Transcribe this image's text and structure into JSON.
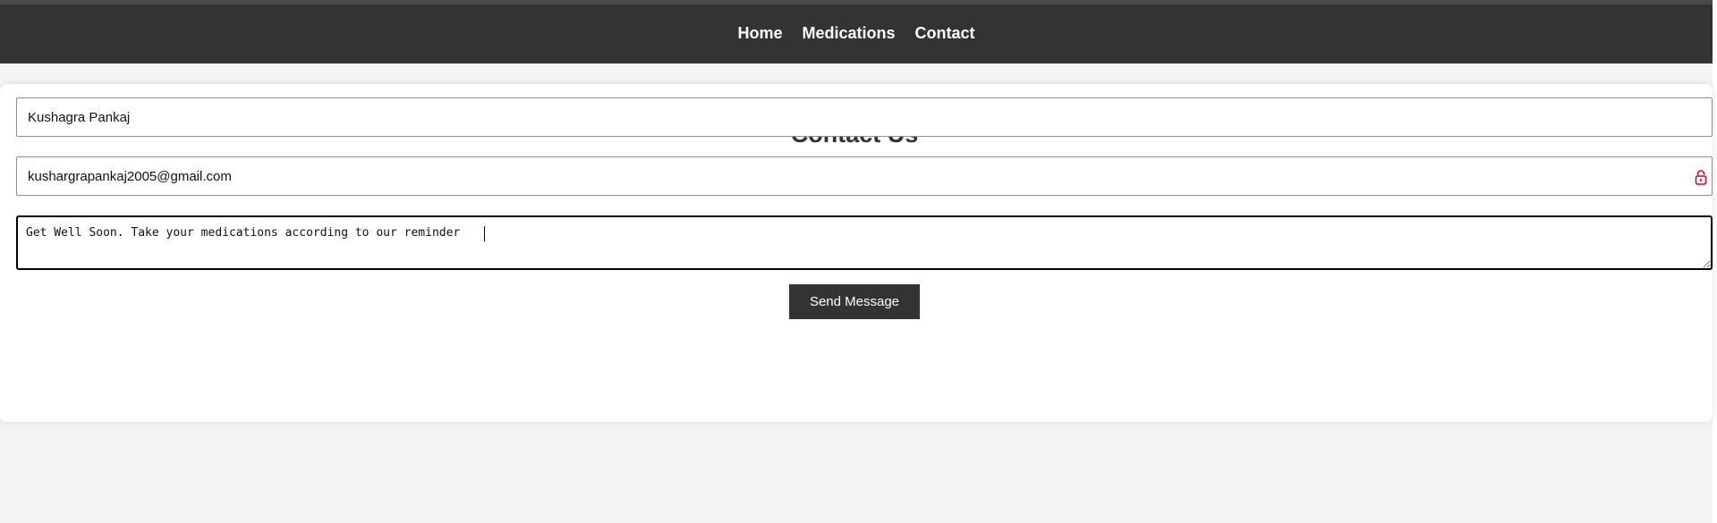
{
  "nav": {
    "items": [
      {
        "label": "Home"
      },
      {
        "label": "Medications"
      },
      {
        "label": "Contact"
      }
    ]
  },
  "contact": {
    "title": "Contact Us",
    "name_value": "Kushagra Pankaj",
    "email_value": "kushargrapankaj2005@gmail.com",
    "email_icon": "lock-icon",
    "message_value": "Get Well Soon. Take your medications according to our reminder",
    "send_label": "Send Message"
  },
  "colors": {
    "navbar_bg": "#333333",
    "page_bg": "#f4f4f4",
    "button_bg": "#333333",
    "lock_icon": "#e0001b"
  }
}
